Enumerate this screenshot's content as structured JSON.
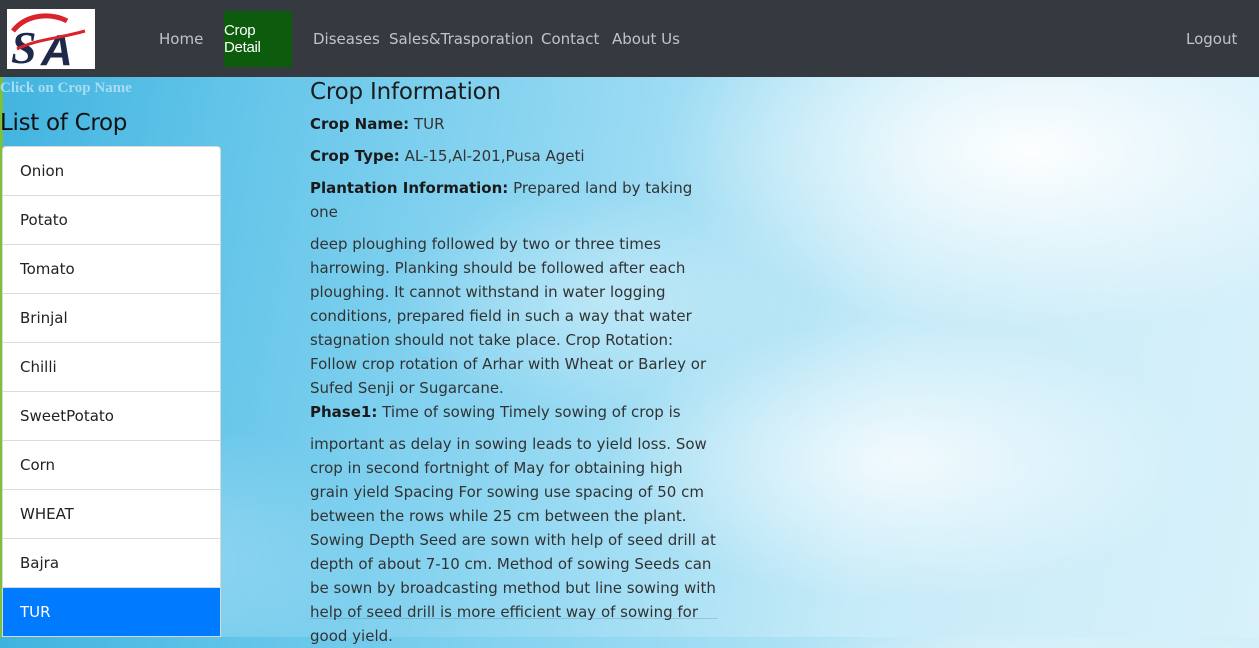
{
  "nav": {
    "logo_text": "SA",
    "links": [
      "Home",
      "Crop Detail",
      "Diseases",
      "Sales&Trasporation",
      "Contact",
      "About Us"
    ],
    "active": "Crop Detail",
    "logout": "Logout"
  },
  "sidebar": {
    "hint": "Click on Crop Name",
    "title": "List of Crop",
    "crops": [
      "Onion",
      "Potato",
      "Tomato",
      "Brinjal",
      "Chilli",
      "SweetPotato",
      "Corn",
      "WHEAT",
      "Bajra",
      "TUR"
    ],
    "selected": "TUR"
  },
  "crop_info": {
    "heading": "Crop Information",
    "name_label": "Crop Name:",
    "name_value": "TUR",
    "type_label": "Crop Type:",
    "type_value": "AL-15,Al-201,Pusa Ageti",
    "plantation_label": "Plantation Information:",
    "plantation_lead": "Prepared land by taking one",
    "plantation_rest": "deep ploughing followed by two or three times harrowing. Planking should be followed after each ploughing. It cannot withstand in water logging conditions, prepared field in such a way that water stagnation should not take place. Crop Rotation: Follow crop rotation of Arhar with Wheat or Barley or Sufed Senji or Sugarcane.",
    "phase1_label": "Phase1:",
    "phase1_lead": "Time of sowing Timely sowing of crop is",
    "phase1_rest": "important as delay in sowing leads to yield loss. Sow crop in second fortnight of May for obtaining high grain yield Spacing For sowing use spacing of 50 cm between the rows while 25 cm between the plant. Sowing Depth Seed are sown with help of seed drill at depth of about 7-10 cm. Method of sowing Seeds can be sown by broadcasting method but line sowing with help of seed drill is more efficient way of sowing for good yield."
  },
  "colors": {
    "navbar": "#343a40",
    "active_tab": "#0d5c0d",
    "selected_item": "#007bff",
    "accent_left": "#7ec03a"
  }
}
